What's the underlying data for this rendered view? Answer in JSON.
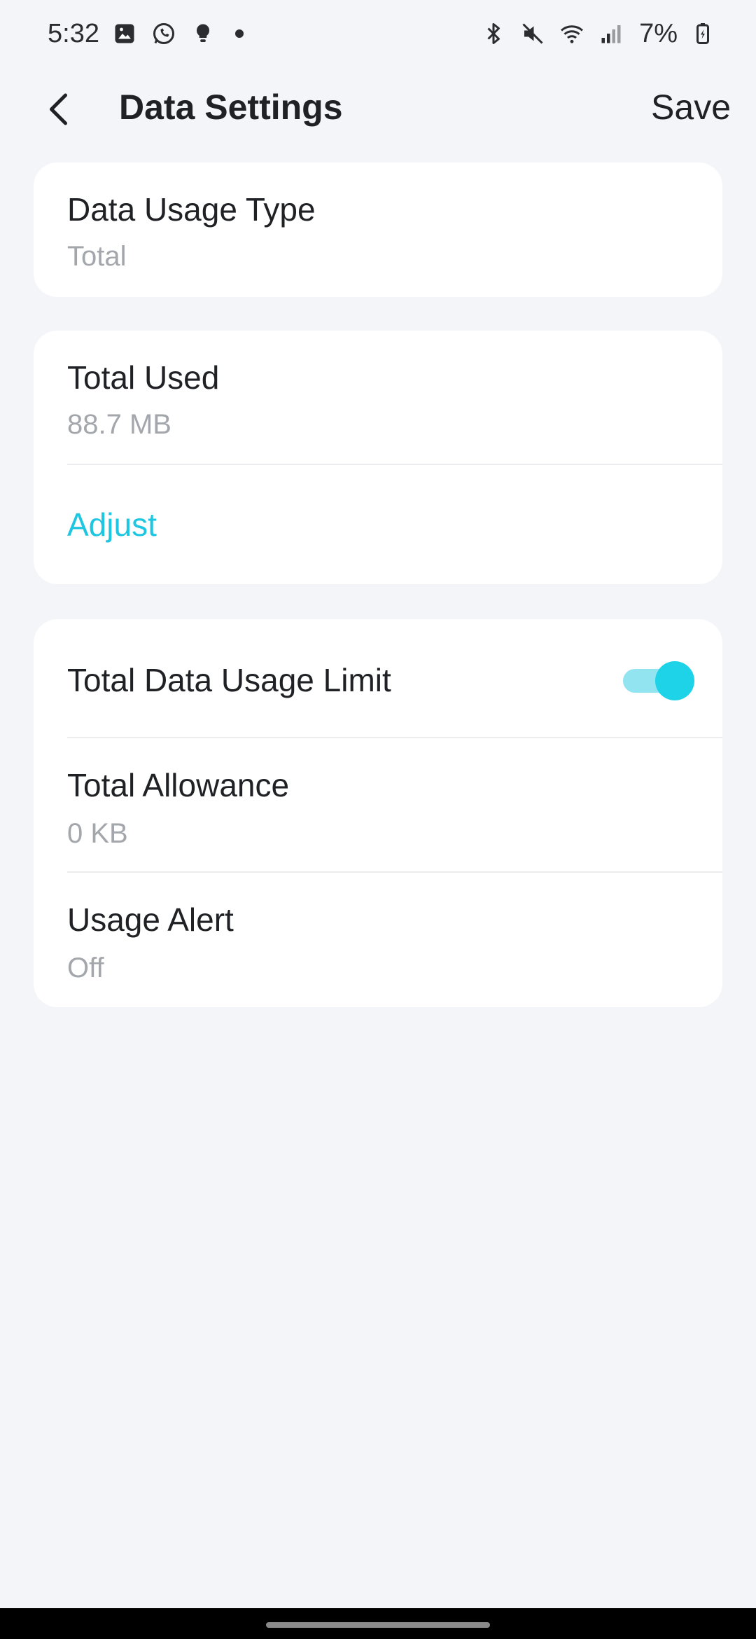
{
  "status_bar": {
    "time": "5:32",
    "left_icons": [
      "gallery-icon",
      "whatsapp-icon",
      "bulb-icon",
      "dot-icon"
    ],
    "right_icons": [
      "bluetooth-icon",
      "mute-icon",
      "wifi-icon",
      "signal-icon",
      "battery-icon"
    ],
    "battery": "7%"
  },
  "app_bar": {
    "title": "Data Settings",
    "save_label": "Save",
    "back_icon": "chevron-left-icon"
  },
  "usage_type": {
    "label": "Data Usage Type",
    "value": "Total"
  },
  "total_used": {
    "label": "Total Used",
    "value": "88.7 MB",
    "adjust_label": "Adjust"
  },
  "limit": {
    "label": "Total Data Usage Limit",
    "enabled": true,
    "allowance_label": "Total Allowance",
    "allowance_value": "0 KB",
    "alert_label": "Usage Alert",
    "alert_value": "Off"
  },
  "colors": {
    "accent": "#1ec6e1",
    "background": "#f4f5f9",
    "card": "#ffffff",
    "secondary_text": "#a3a6ab"
  }
}
